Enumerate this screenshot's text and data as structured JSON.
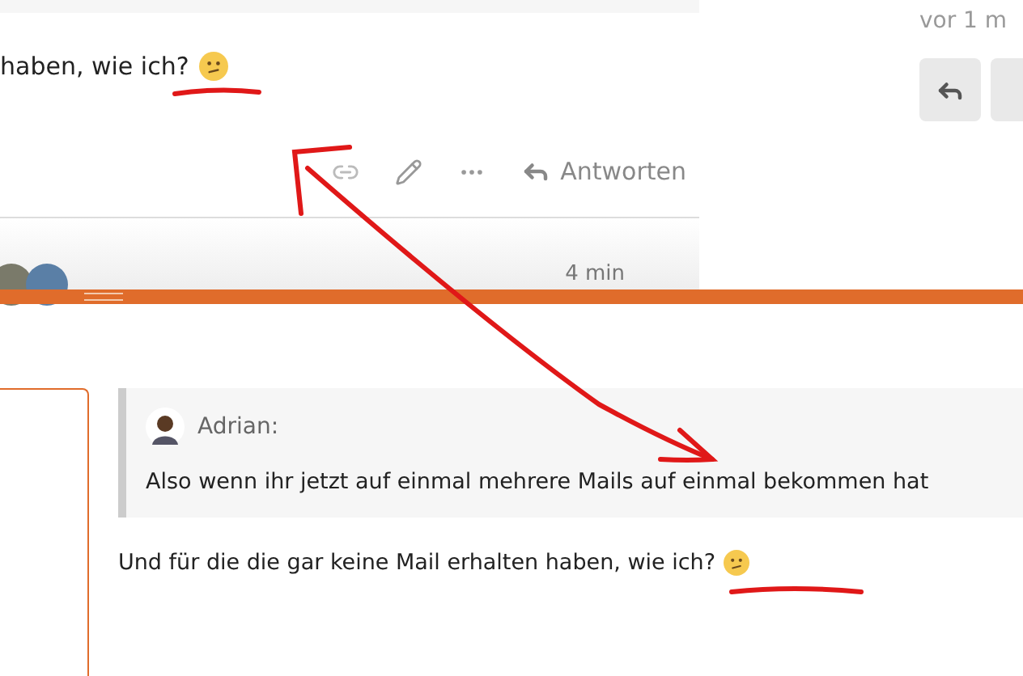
{
  "post": {
    "text": "haben, wie ich?",
    "reply_label": "Antworten",
    "time": "4 min"
  },
  "sidebar": {
    "time": "vor 1 m"
  },
  "preview": {
    "quote": {
      "author": "Adrian:",
      "text": "Also wenn ihr jetzt auf einmal mehrere Mails auf einmal bekommen hat"
    },
    "text": "Und für die die gar keine Mail erhalten haben, wie ich?"
  }
}
